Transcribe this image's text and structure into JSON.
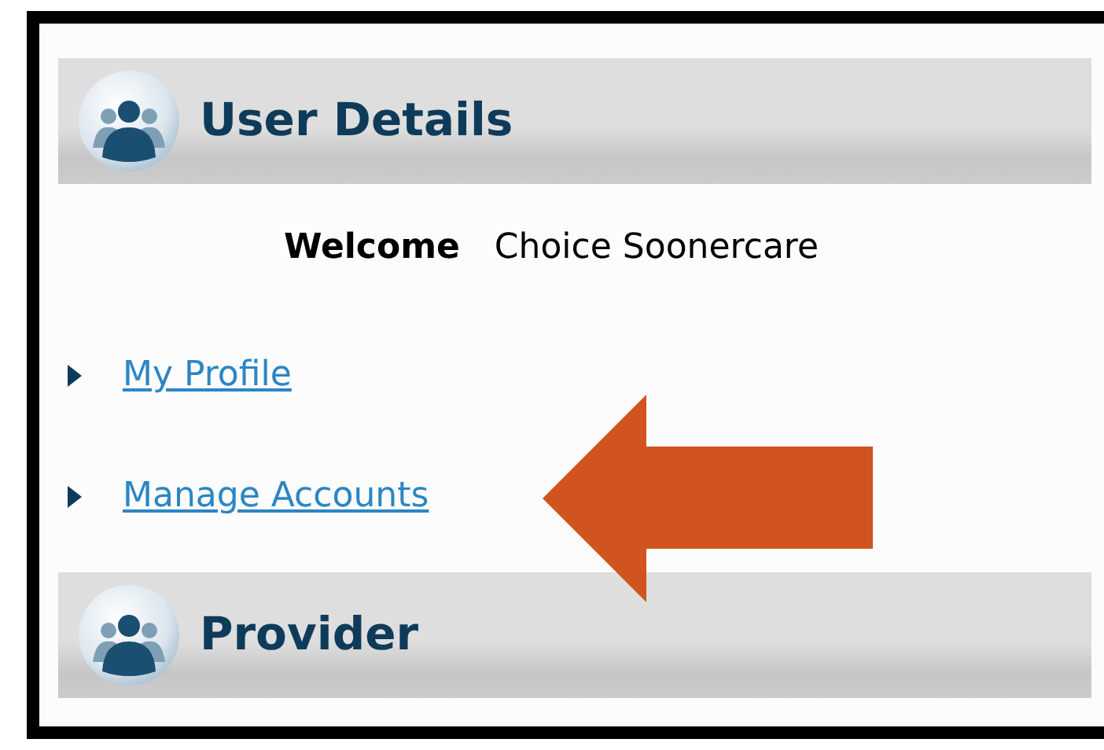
{
  "sections": [
    {
      "title": "User Details"
    },
    {
      "title": "Provider"
    }
  ],
  "welcome": {
    "label": "Welcome",
    "name": "Choice Soonercare"
  },
  "links": [
    {
      "label": "My Profile"
    },
    {
      "label": "Manage Accounts"
    }
  ]
}
